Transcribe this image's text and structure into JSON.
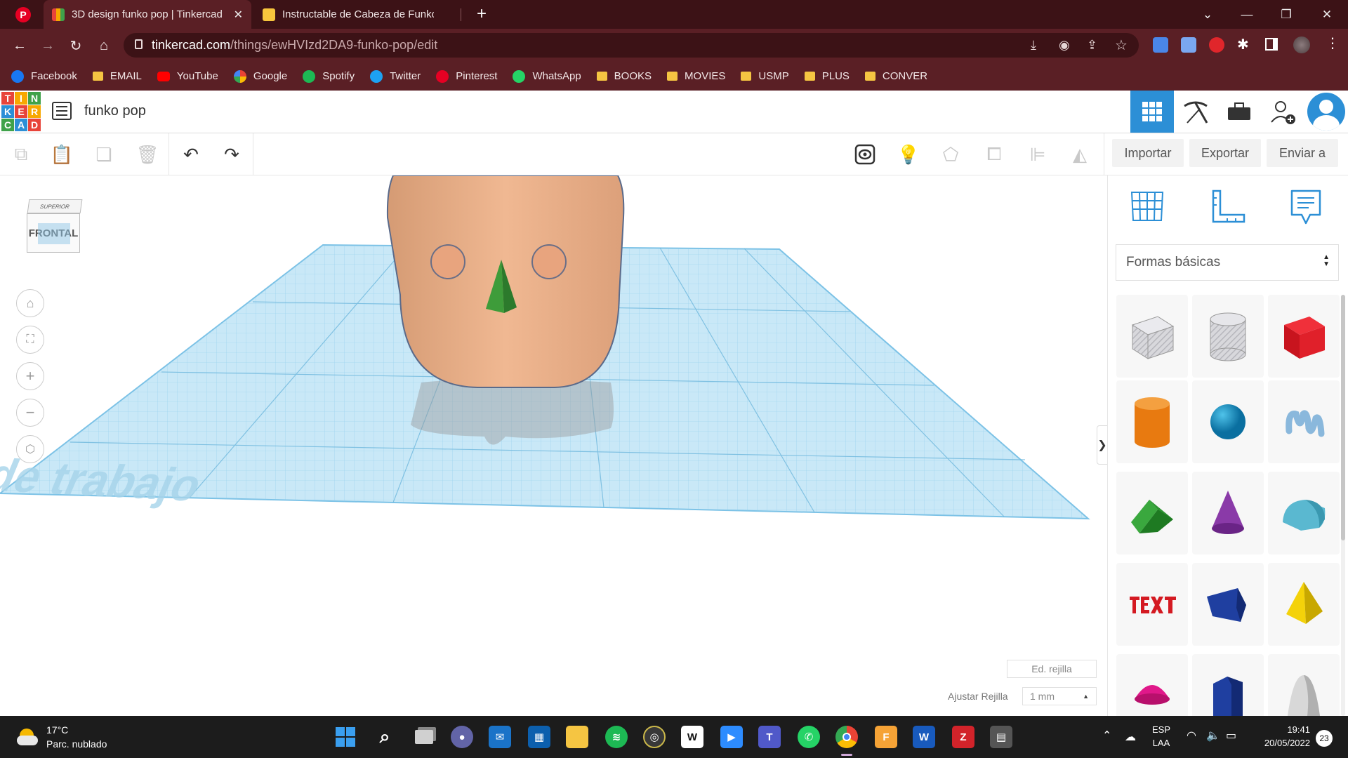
{
  "browser": {
    "tabs": [
      {
        "title": "3D design funko pop | Tinkercad",
        "active": true
      },
      {
        "title": "Instructable de Cabeza de Funko",
        "active": false
      }
    ],
    "new_tab_symbol": "+",
    "url_host": "tinkercad.com",
    "url_path": "/things/ewHVIzd2DA9-funko-pop/edit",
    "bookmarks": [
      {
        "label": "Facebook",
        "kind": "facebook-icon",
        "color": "#1877f2"
      },
      {
        "label": "EMAIL",
        "kind": "folder-icon",
        "color": "#f5c542"
      },
      {
        "label": "YouTube",
        "kind": "youtube-icon",
        "color": "#ff0000"
      },
      {
        "label": "Google",
        "kind": "google-icon",
        "color": "#ffffff"
      },
      {
        "label": "Spotify",
        "kind": "spotify-icon",
        "color": "#1db954"
      },
      {
        "label": "Twitter",
        "kind": "twitter-icon",
        "color": "#1da1f2"
      },
      {
        "label": "Pinterest",
        "kind": "pinterest-icon",
        "color": "#e60023"
      },
      {
        "label": "WhatsApp",
        "kind": "whatsapp-icon",
        "color": "#25d366"
      },
      {
        "label": "BOOKS",
        "kind": "folder-icon",
        "color": "#f5c542"
      },
      {
        "label": "MOVIES",
        "kind": "folder-icon",
        "color": "#f5c542"
      },
      {
        "label": "USMP",
        "kind": "folder-icon",
        "color": "#f5c542"
      },
      {
        "label": "PLUS",
        "kind": "folder-icon",
        "color": "#f5c542"
      },
      {
        "label": "CONVER",
        "kind": "folder-icon",
        "color": "#f5c542"
      }
    ]
  },
  "tinkercad": {
    "logo_letters": [
      "T",
      "I",
      "N",
      "K",
      "E",
      "R",
      "C",
      "A",
      "D"
    ],
    "project_title": "funko pop",
    "toolbar": {
      "import_label": "Importar",
      "export_label": "Exportar",
      "send_label": "Enviar a"
    },
    "viewcube": {
      "top_label": "SUPERIOR",
      "front_label": "FRONTAL"
    },
    "workplane_label": "Plano de trabajo",
    "shapes_dropdown": "Formas básicas",
    "panel_toggle": "❯",
    "grid_edit_label": "Ed. rejilla",
    "snap_grid_label": "Ajustar Rejilla",
    "snap_grid_value": "1 mm",
    "accent_color": "#2c8fd6"
  },
  "taskbar": {
    "weather_temp": "17°C",
    "weather_desc": "Parc. nublado",
    "lang_top": "ESP",
    "lang_bottom": "LAA",
    "time": "19:41",
    "date": "20/05/2022",
    "notification_count": "23"
  }
}
